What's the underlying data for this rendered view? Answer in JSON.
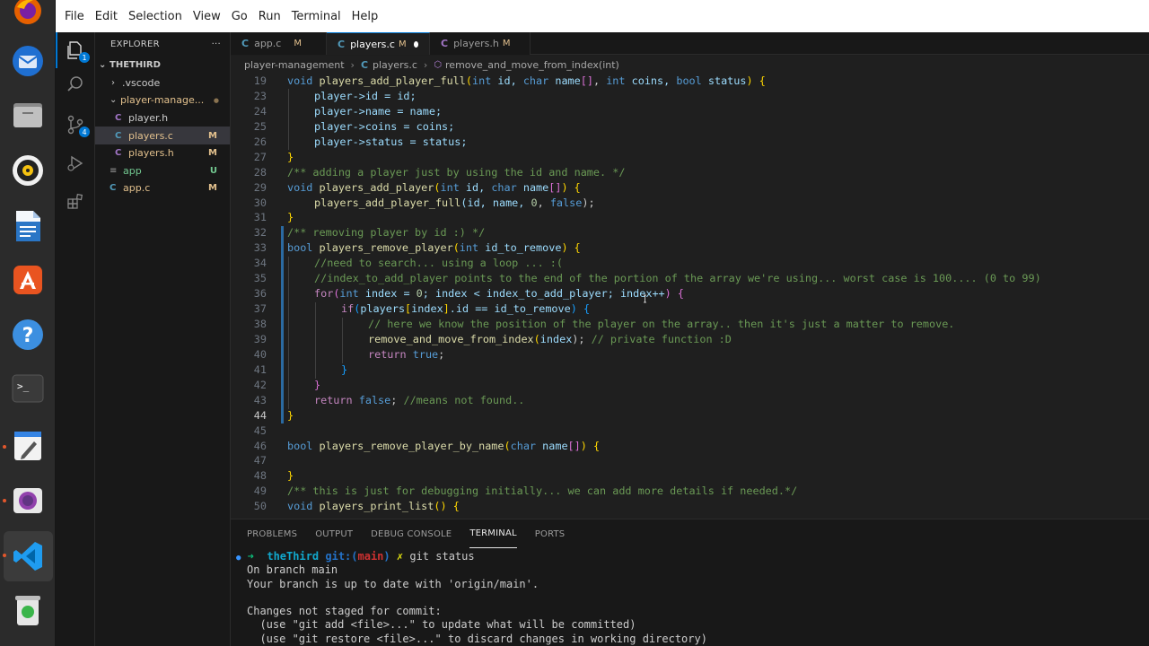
{
  "menubar": {
    "items": [
      "File",
      "Edit",
      "Selection",
      "View",
      "Go",
      "Run",
      "Terminal",
      "Help"
    ]
  },
  "dock": {
    "apps": [
      "firefox-icon",
      "thunderbird-icon",
      "files-icon",
      "rhythmbox-icon",
      "libreoffice-writer-icon",
      "app-center-icon",
      "help-icon",
      "terminal-icon",
      "text-editor-icon",
      "screenshot-icon",
      "vscode-icon",
      "trash-icon"
    ]
  },
  "activity": {
    "explorer_badge": "1",
    "scm_badge": "4"
  },
  "explorer": {
    "title": "EXPLORER",
    "more": "···",
    "root": "THETHIRD",
    "items": [
      {
        "label": ".vscode",
        "icon": "›",
        "status": ""
      },
      {
        "label": "player-manage...",
        "icon": "⌄",
        "status": "●"
      },
      {
        "label": "player.h",
        "icon": "C",
        "status": ""
      },
      {
        "label": "players.c",
        "icon": "C",
        "status": "M"
      },
      {
        "label": "players.h",
        "icon": "C",
        "status": "M"
      },
      {
        "label": "app",
        "icon": "≡",
        "status": "U"
      },
      {
        "label": "app.c",
        "icon": "C",
        "status": "M"
      }
    ]
  },
  "tabs": [
    {
      "icon": "C",
      "label": "app.c",
      "mod": "M"
    },
    {
      "icon": "C",
      "label": "players.c",
      "mod": "M"
    },
    {
      "icon": "C",
      "label": "players.h",
      "mod": "M"
    }
  ],
  "breadcrumb": {
    "folder": "player-management",
    "file_icon": "C",
    "file": "players.c",
    "symbol": "remove_and_move_from_index(int)"
  },
  "code": {
    "line_numbers": [
      "19",
      "23",
      "24",
      "25",
      "26",
      "27",
      "28",
      "29",
      "30",
      "31",
      "32",
      "33",
      "34",
      "35",
      "36",
      "37",
      "38",
      "39",
      "40",
      "41",
      "42",
      "43",
      "44",
      "45",
      "46",
      "47",
      "48",
      "49",
      "50"
    ],
    "l19": [
      "void",
      " ",
      "players_add_player_full",
      "(",
      "int",
      " id, ",
      "char",
      " name",
      "[]",
      ", ",
      "int",
      " coins, ",
      "bool",
      " status",
      ")",
      " {"
    ],
    "l23": "player->id = id;",
    "l24": "player->name = name;",
    "l25": "player->coins = coins;",
    "l26": "player->status = status;",
    "l28": "/** adding a player just by using the id and name. */",
    "l29": [
      "void",
      " ",
      "players_add_player",
      "(",
      "int",
      " id, ",
      "char",
      " name",
      "[]",
      ")",
      " {"
    ],
    "l30": [
      "players_add_player_full",
      "(id, name, ",
      "0",
      ", ",
      "false",
      ");"
    ],
    "l32": "/** removing player by id :) */",
    "l33": [
      "bool",
      " ",
      "players_remove_player",
      "(",
      "int",
      " id_to_remove",
      ")",
      " {"
    ],
    "l34": "//need to search... using a loop ... :(",
    "l35": "//index_to_add_player points to the end of the portion of the array we're using... worst case is 100.... (0 to 99)",
    "l36": [
      "for",
      "(",
      "int",
      " index = ",
      "0",
      "; index < index_to_add_player; index++",
      ")",
      " {"
    ],
    "l37": [
      "if",
      "(",
      "players",
      "[",
      "index",
      "]",
      ".id == id_to_remove",
      ")",
      " {"
    ],
    "l38": "// here we know the position of the player on the array.. then it's just a matter to remove.",
    "l39": [
      "remove_and_move_from_index",
      "(",
      "index",
      ");",
      " // private function :D"
    ],
    "l40": [
      "return",
      " ",
      "true",
      ";"
    ],
    "l43": [
      "return",
      " ",
      "false",
      ";",
      " //means not found.."
    ],
    "l46": [
      "bool",
      " ",
      "players_remove_player_by_name",
      "(",
      "char",
      " name",
      "[]",
      ")",
      " {"
    ],
    "l49": "/** this is just for debugging initially... we can add more details if needed.*/",
    "l50": [
      "void",
      " ",
      "players_print_list",
      "()",
      " {"
    ]
  },
  "panel": {
    "tabs": [
      "PROBLEMS",
      "OUTPUT",
      "DEBUG CONSOLE",
      "TERMINAL",
      "PORTS"
    ],
    "active": "TERMINAL"
  },
  "terminal": {
    "prompt_arrow": "➜",
    "dir": "theThird",
    "git_label": "git:(",
    "branch": "main",
    "git_close": ")",
    "dirty": "✗",
    "command": "git status",
    "lines": [
      "On branch main",
      "Your branch is up to date with 'origin/main'.",
      "",
      "Changes not staged for commit:",
      "  (use \"git add <file>...\" to update what will be committed)",
      "  (use \"git restore <file>...\" to discard changes in working directory)"
    ]
  },
  "colors": {
    "accent": "#0078d4",
    "modified": "#e2c08d",
    "untracked": "#73c991",
    "keyword": "#569cd6",
    "function": "#dcdcaa",
    "comment": "#6a9955"
  }
}
